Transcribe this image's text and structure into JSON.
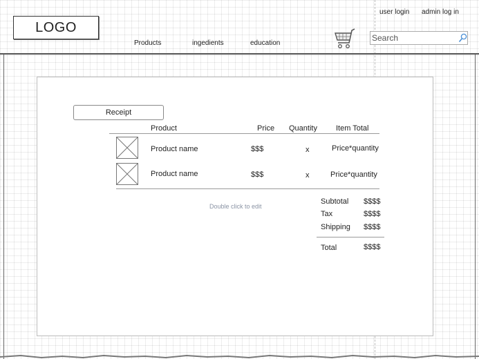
{
  "header": {
    "logo": "LOGO",
    "nav": [
      "Products",
      "ingedients",
      "education"
    ],
    "user_login": "user login",
    "admin_login": "admin log in",
    "search_placeholder": "Search"
  },
  "receipt": {
    "button_label": "Receipt",
    "columns": [
      "Product",
      "Price",
      "Quantity",
      "Item Total"
    ],
    "rows": [
      {
        "name": "Product name",
        "price": "$$$",
        "quantity": "x",
        "total": "Price*quantity"
      },
      {
        "name": "Product name",
        "price": "$$$",
        "quantity": "x",
        "total": "Price*quantity"
      }
    ],
    "hint": "Double click to edit",
    "summary": {
      "subtotal_label": "Subtotal",
      "subtotal_value": "$$$$",
      "tax_label": "Tax",
      "tax_value": "$$$$",
      "shipping_label": "Shipping",
      "shipping_value": "$$$$",
      "total_label": "Total",
      "total_value": "$$$$"
    }
  },
  "icons": {
    "cart": "shopping-cart-icon",
    "search": "magnifier-icon",
    "image_placeholder": "image-placeholder-icon"
  }
}
